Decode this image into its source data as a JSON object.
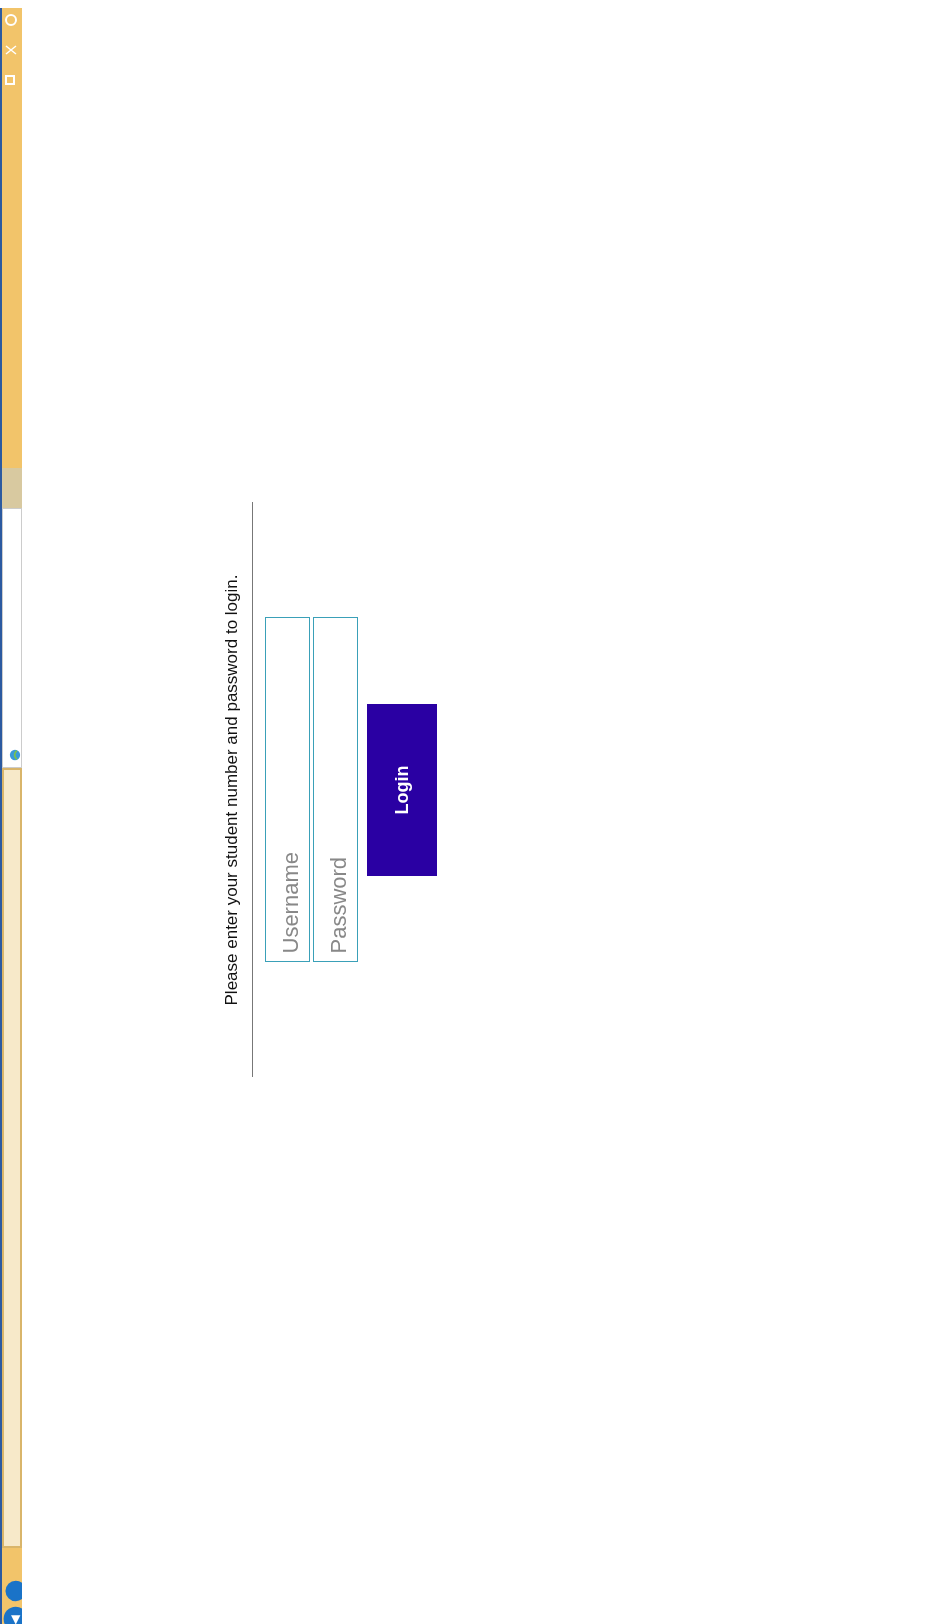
{
  "login_form": {
    "instruction": "Please enter your student number and password to login.",
    "username": {
      "placeholder": "Username"
    },
    "password": {
      "placeholder": "Password"
    },
    "button": "Login"
  }
}
